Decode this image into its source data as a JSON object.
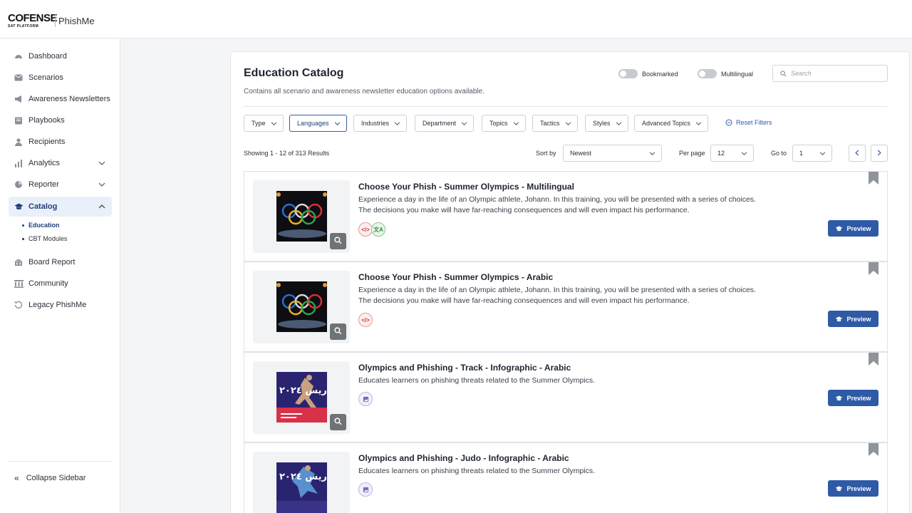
{
  "brand": {
    "logo": "COFENSE",
    "logo_sub": "SAT PLATFORM",
    "product": "PhishMe"
  },
  "sidebar": {
    "items": [
      {
        "label": "Dashboard",
        "icon": "dashboard-icon"
      },
      {
        "label": "Scenarios",
        "icon": "envelope-icon"
      },
      {
        "label": "Awareness Newsletters",
        "icon": "megaphone-icon"
      },
      {
        "label": "Playbooks",
        "icon": "book-icon"
      },
      {
        "label": "Recipients",
        "icon": "users-icon"
      },
      {
        "label": "Analytics",
        "icon": "bar-chart-icon"
      },
      {
        "label": "Reporter",
        "icon": "pie-chart-icon"
      },
      {
        "label": "Catalog",
        "icon": "graduation-cap-icon"
      },
      {
        "label": "Board Report",
        "icon": "building-icon"
      },
      {
        "label": "Community",
        "icon": "community-icon"
      },
      {
        "label": "Legacy PhishMe",
        "icon": "history-icon"
      }
    ],
    "catalog_sub": [
      "Education",
      "CBT Modules"
    ],
    "collapse_label": "Collapse Sidebar"
  },
  "header": {
    "title": "Education Catalog",
    "subtitle": "Contains all scenario and awareness newsletter education options available.",
    "toggle_bookmarked": "Bookmarked",
    "toggle_multilingual": "Multilingual",
    "search_placeholder": "Search"
  },
  "filters": [
    "Type",
    "Languages",
    "Industries",
    "Department",
    "Topics",
    "Tactics",
    "Styles",
    "Advanced Topics"
  ],
  "reset_filters": "Reset Filters",
  "results": {
    "showing": "Showing 1 - 12 of 313 Results",
    "sort_label": "Sort by",
    "sort_value": "Newest",
    "per_page_label": "Per page",
    "per_page_value": "12",
    "goto_label": "Go to",
    "goto_value": "1"
  },
  "cards": [
    {
      "title": "Choose Your Phish - Summer Olympics - Multilingual",
      "desc": "Experience a day in the life of an Olympic athlete, Johann. In this training, you will be presented with a series of choices. The decisions you make will have far-reaching consequences and will even impact his performance.",
      "preview": "Preview"
    },
    {
      "title": "Choose Your Phish - Summer Olympics - Arabic",
      "desc": "Experience a day in the life of an Olympic athlete, Johann. In this training, you will be presented with a series of choices. The decisions you make will have far-reaching consequences and will even impact his performance.",
      "preview": "Preview"
    },
    {
      "title": "Olympics and Phishing - Track - Infographic - Arabic",
      "desc": "Educates learners on phishing threats related to the Summer Olympics.",
      "preview": "Preview"
    },
    {
      "title": "Olympics and Phishing - Judo - Infographic - Arabic",
      "desc": "Educates learners on phishing threats related to the Summer Olympics.",
      "preview": "Preview"
    }
  ],
  "poster_text": "باريس ٢٠٢٤",
  "colors": {
    "accent": "#2e5aa6",
    "active_bg": "#eaf0f9",
    "code_badge": "#c33",
    "multilingual_badge": "#2f8a3a"
  }
}
